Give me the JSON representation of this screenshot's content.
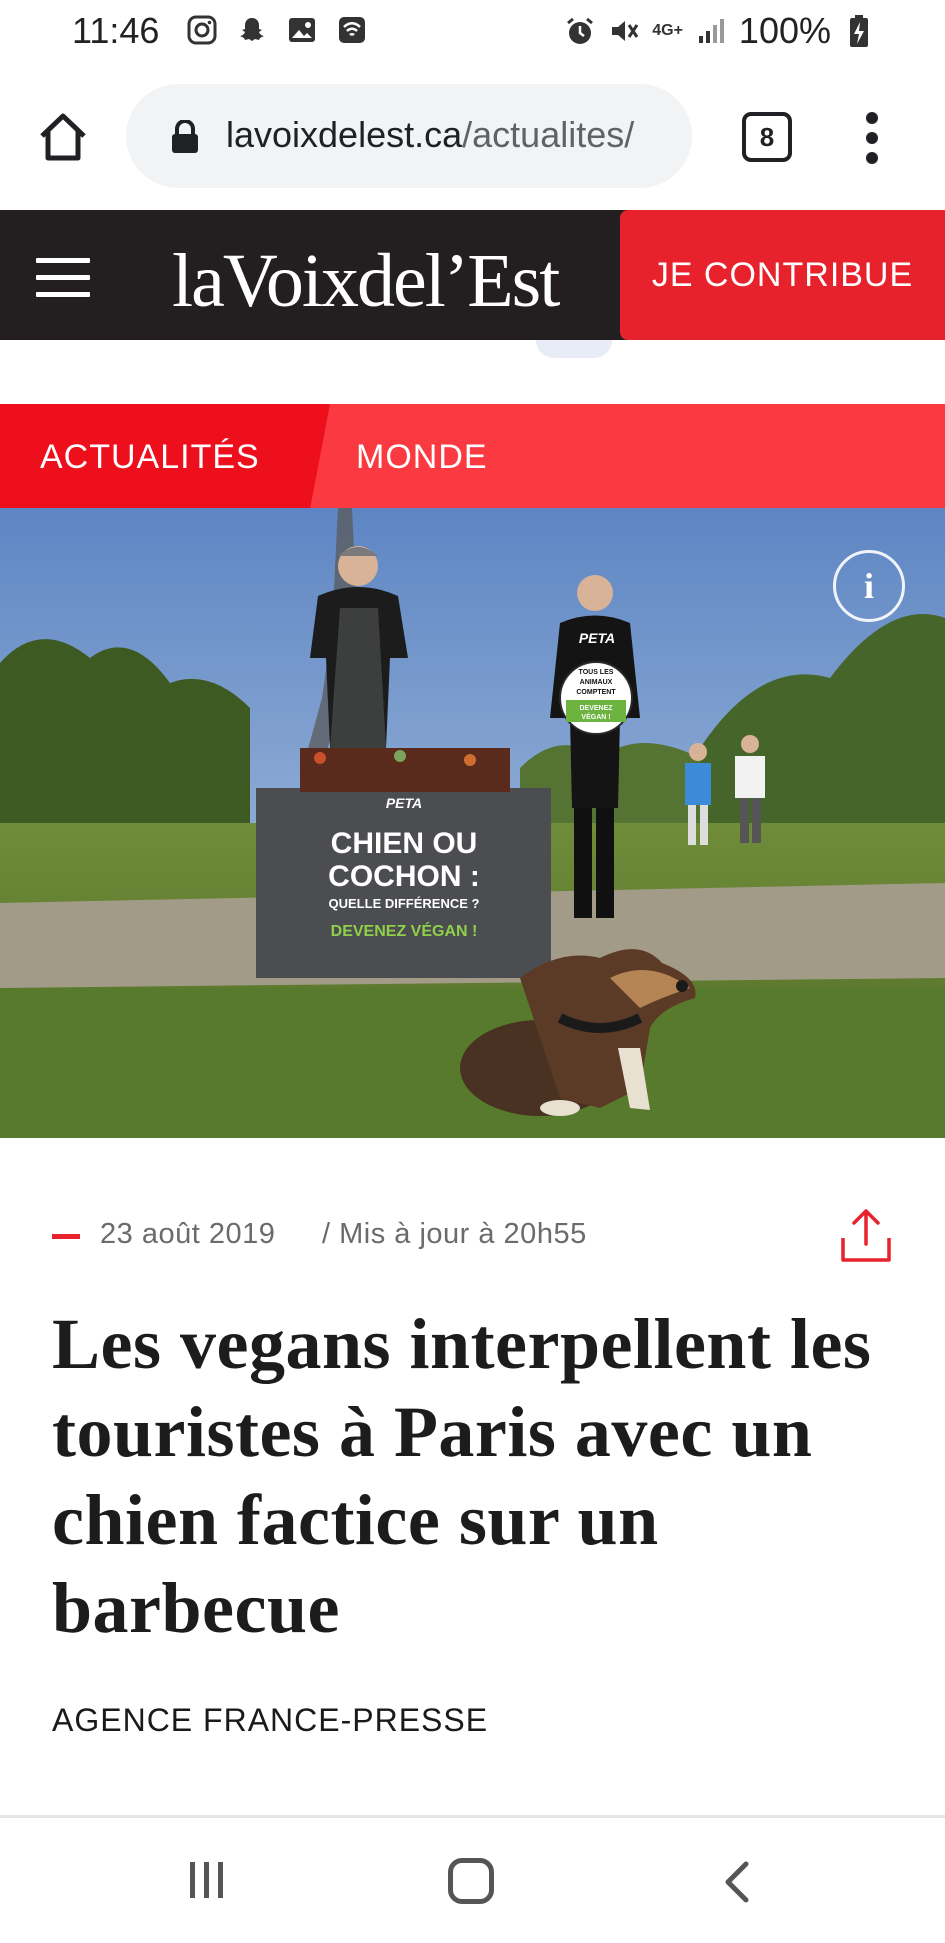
{
  "status_bar": {
    "time": "11:46",
    "battery": "100%",
    "network": "4G+",
    "icons": [
      "instagram-icon",
      "snapchat-icon",
      "gallery-icon",
      "wifi-calling-icon",
      "alarm-icon",
      "mute-icon",
      "signal-icon",
      "battery-charging-icon"
    ]
  },
  "browser": {
    "url_domain": "lavoixdelest.ca",
    "url_path": "/actualites/",
    "tab_count": "8"
  },
  "site": {
    "logo": "laVoixdel’Est",
    "contribute_label": "JE CONTRIBUE"
  },
  "sections": {
    "active": "ACTUALITÉS",
    "secondary": "MONDE"
  },
  "hero": {
    "info_label": "i",
    "sign_brand": "PETA",
    "sign_line1": "CHIEN OU",
    "sign_line2": "COCHON :",
    "sign_line3": "QUELLE DIFFÉRENCE ?",
    "sign_line4": "DEVENEZ VÉGAN !",
    "placard_line1": "TOUS LES",
    "placard_line2": "ANIMAUX",
    "placard_line3": "COMPTENT",
    "placard_line4": "DEVENEZ",
    "placard_line5": "VÉGAN !",
    "shirt_text": "PETA"
  },
  "article": {
    "date": "23 août 2019",
    "updated": "/ Mis à jour à 20h55",
    "headline": "Les vegans interpellent les touristes à Paris avec un chien factice sur un barbecue",
    "byline": "AGENCE FRANCE-PRESSE"
  },
  "colors": {
    "brand_red": "#e8222d",
    "header_dark": "#231f20",
    "section_bar": "#fa3a40",
    "section_active": "#ed0f1c"
  }
}
